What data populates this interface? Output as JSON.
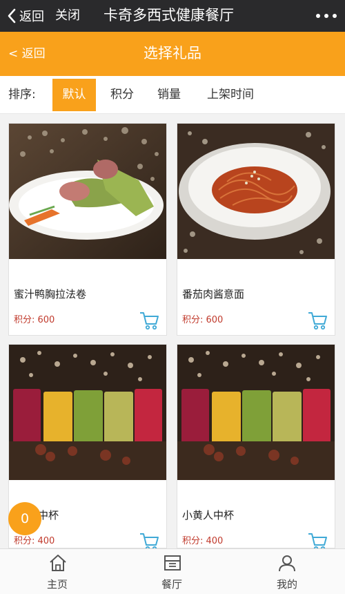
{
  "wechat_bar": {
    "back_label": "返回",
    "close_label": "关闭",
    "title": "卡奇多西式健康餐厅"
  },
  "header": {
    "back_label": "< 返回",
    "title": "选择礼品"
  },
  "sort": {
    "label": "排序:",
    "options": [
      {
        "label": "默认",
        "active": true
      },
      {
        "label": "积分",
        "active": false
      },
      {
        "label": "销量",
        "active": false
      },
      {
        "label": "上架时间",
        "active": false
      }
    ]
  },
  "products": [
    {
      "name": "蜜汁鸭胸拉法卷",
      "points": "积分: 600",
      "image": "wrap-plate-photo"
    },
    {
      "name": "番茄肉酱意面",
      "points": "积分: 600",
      "image": "pasta-bowl-photo"
    },
    {
      "name": "中杯",
      "points": "积分: 400",
      "image": "juice-glasses-photo"
    },
    {
      "name": "小黄人中杯",
      "points": "积分: 400",
      "image": "juice-glasses-photo"
    }
  ],
  "cart_badge": "0",
  "tabbar": [
    {
      "label": "主页",
      "icon": "home-icon"
    },
    {
      "label": "餐厅",
      "icon": "restaurant-icon"
    },
    {
      "label": "我的",
      "icon": "profile-icon"
    }
  ],
  "colors": {
    "accent": "#f9a11b",
    "points": "#c0392b",
    "cart_icon": "#3fa9d6"
  }
}
